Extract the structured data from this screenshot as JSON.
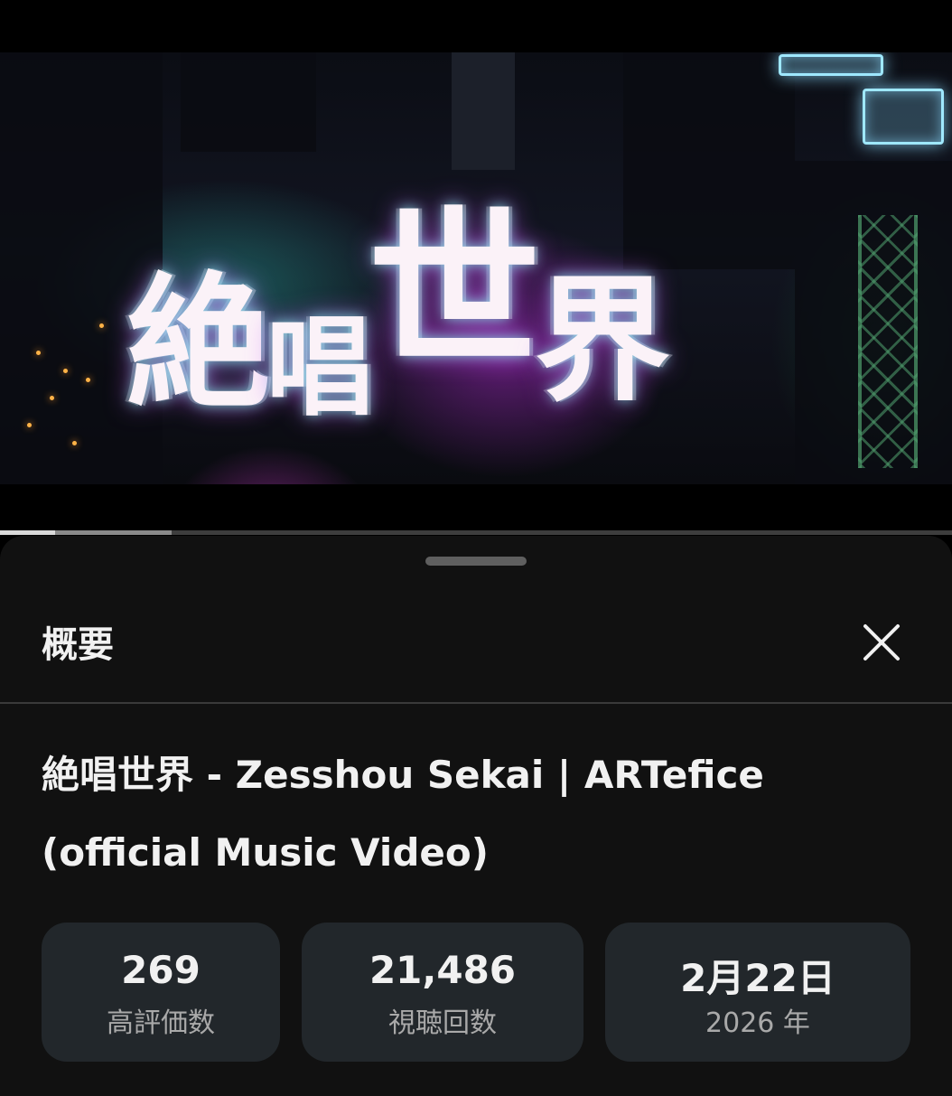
{
  "video": {
    "thumbnail_title": "絶唱世界",
    "progress": {
      "played_fraction": 0.058,
      "buffered_fraction": 0.18
    }
  },
  "description_sheet": {
    "title": "概要",
    "close_icon": "close-icon",
    "video_title": "絶唱世界 - Zesshou Sekai | ARTefice (official Music Video)",
    "stats": [
      {
        "value": "269",
        "label": "高評価数"
      },
      {
        "value": "21,486",
        "label": "視聴回数"
      },
      {
        "value": "2月22日",
        "label": "2026 年"
      }
    ]
  },
  "colors": {
    "sheet_background": "#111111",
    "card_background": "#22272b",
    "primary_text": "#f1f1f1",
    "secondary_text": "#a9a9a9"
  }
}
